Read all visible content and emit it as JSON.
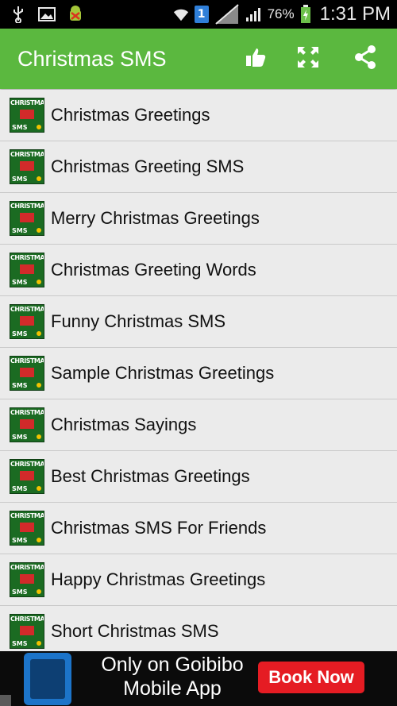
{
  "status_bar": {
    "battery": "76%",
    "time": "1:31 PM",
    "sim_badge": "1",
    "icons": [
      "usb-icon",
      "image-icon",
      "android-debug-icon",
      "wifi-icon",
      "sim-icon",
      "no-signal-icon",
      "signal-icon",
      "battery-charging-icon"
    ]
  },
  "action_bar": {
    "title": "Christmas SMS",
    "actions": [
      "thumbs-up-icon",
      "fullscreen-icon",
      "share-icon"
    ],
    "color": "#5bb83f"
  },
  "list": {
    "thumbnail": {
      "top_text": "CHRISTMAS",
      "bottom_text": "SMS"
    },
    "items": [
      "Christmas Greetings",
      "Christmas Greeting SMS",
      "Merry Christmas Greetings",
      "Christmas Greeting Words",
      "Funny Christmas SMS",
      "Sample Christmas Greetings",
      "Christmas Sayings",
      "Best Christmas Greetings",
      "Christmas SMS For Friends",
      "Happy Christmas Greetings",
      "Short Christmas SMS"
    ]
  },
  "ad": {
    "line1": "Only on Goibibo",
    "line2": "Mobile App",
    "cta": "Book Now"
  }
}
